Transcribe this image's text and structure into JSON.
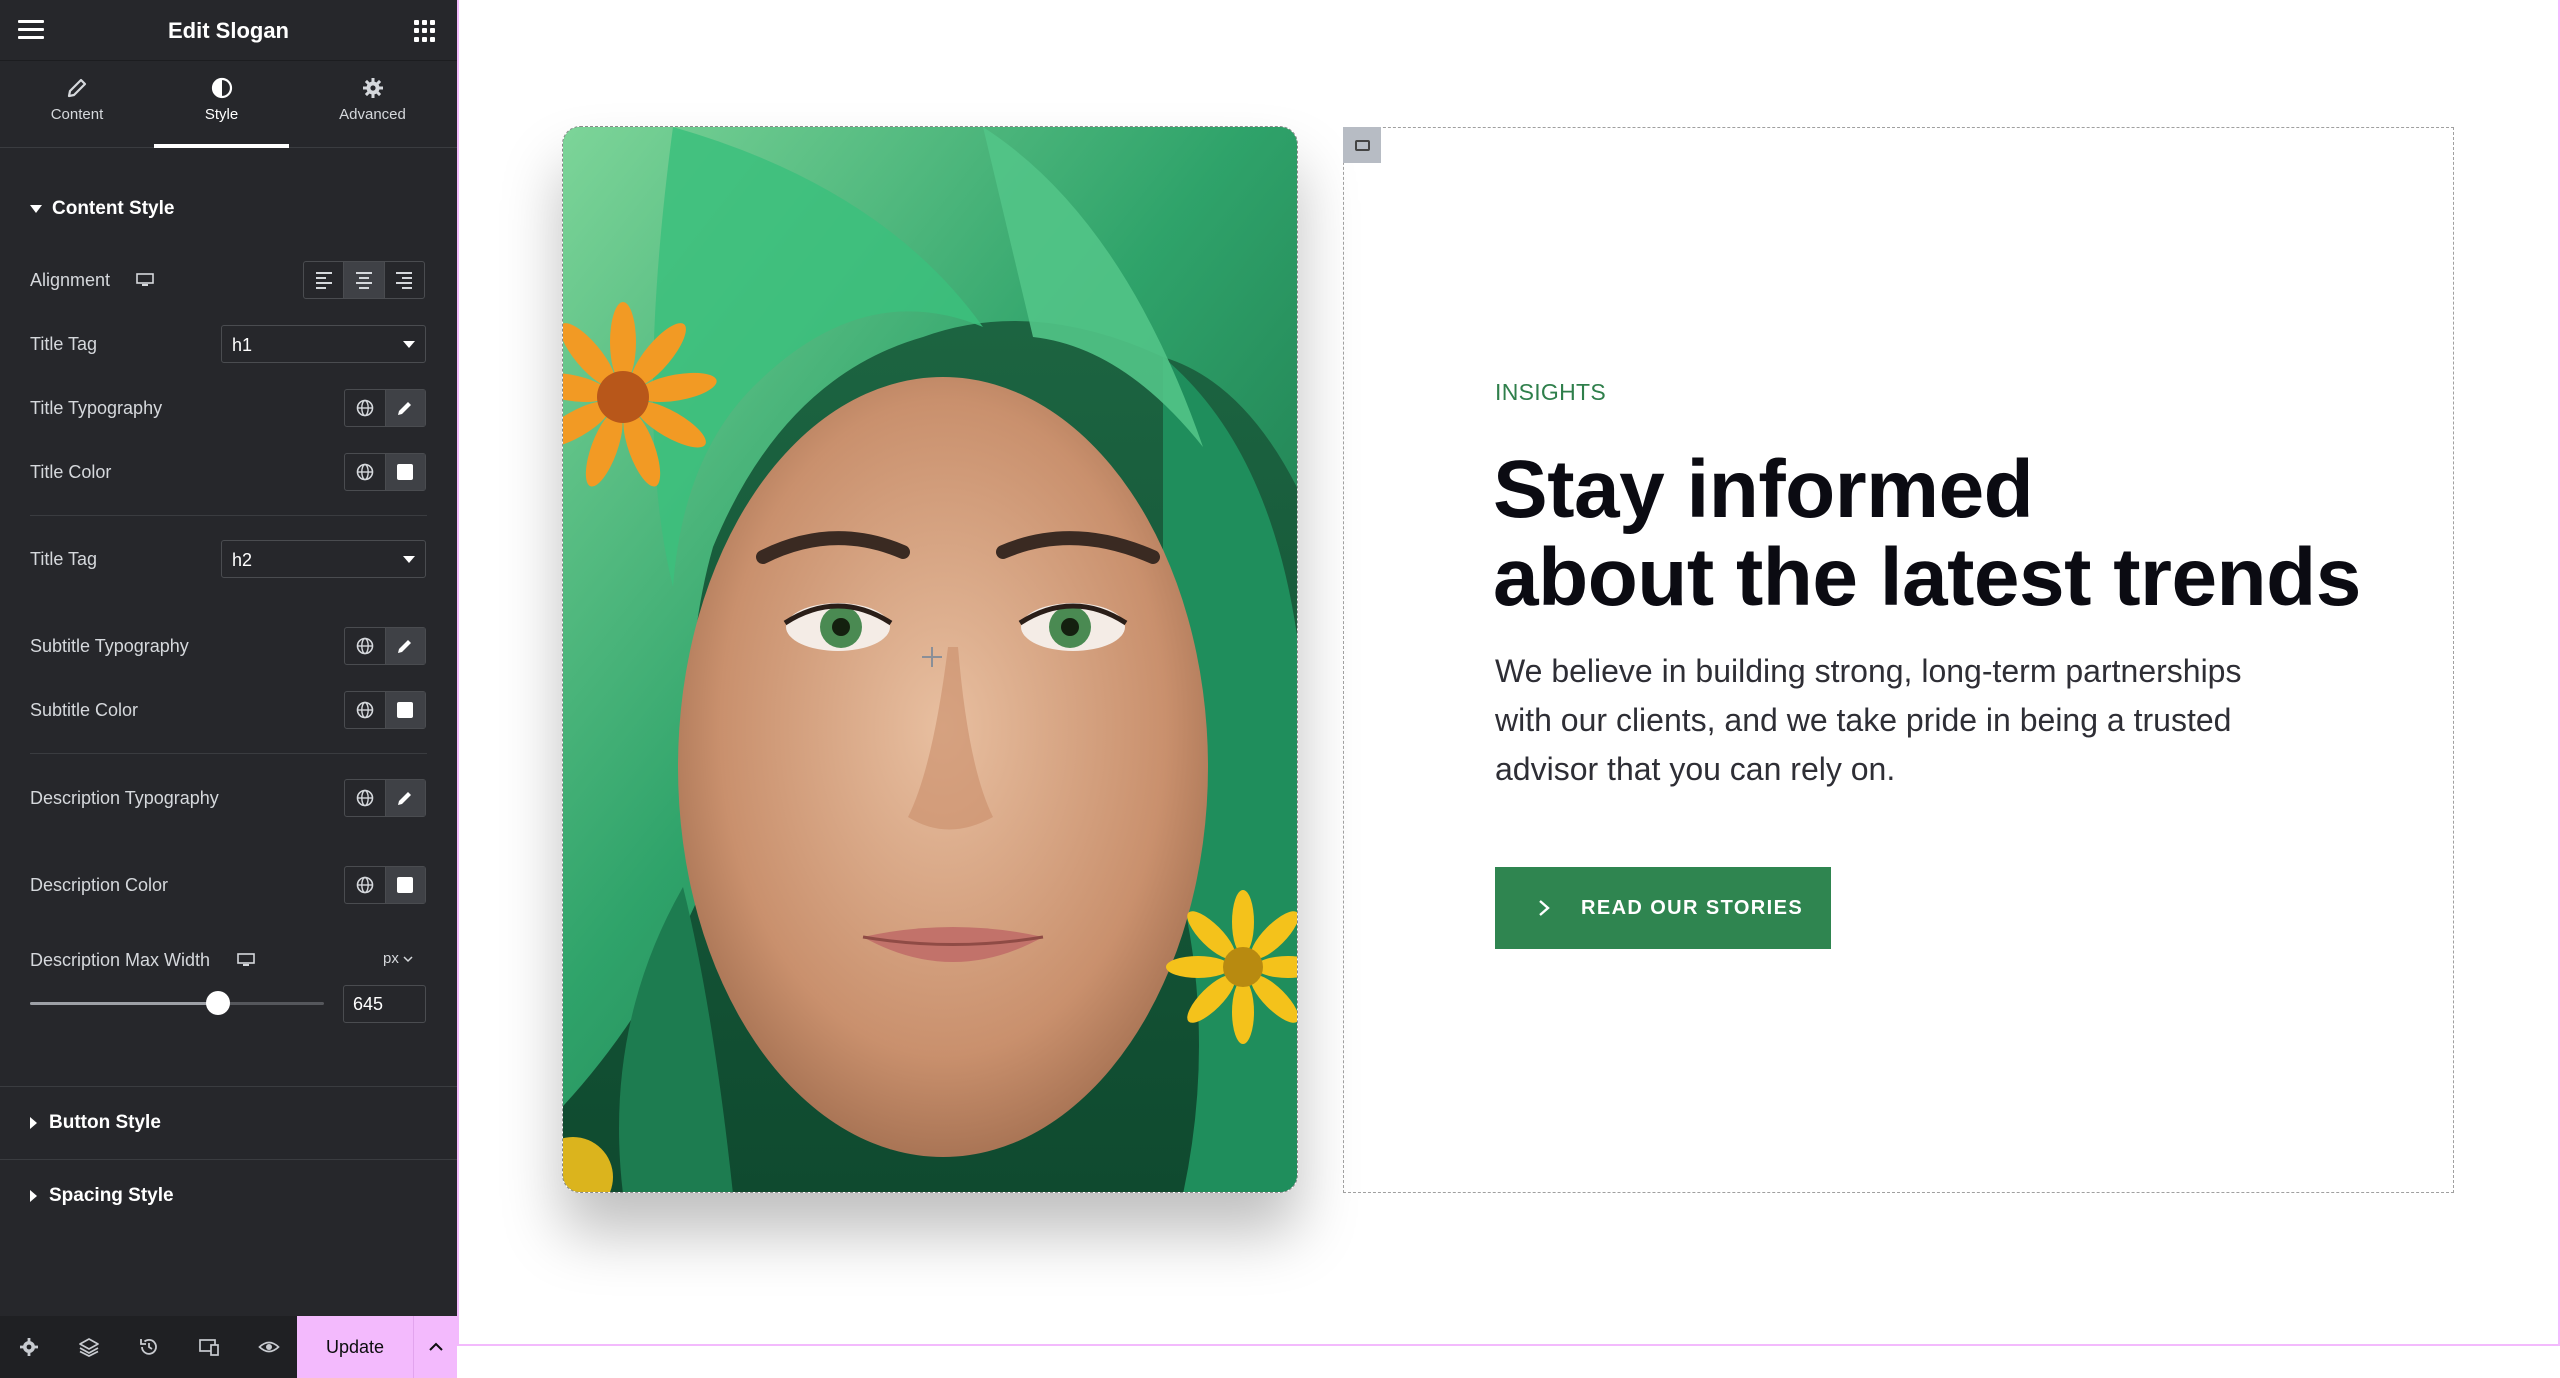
{
  "panel": {
    "title": "Edit Slogan",
    "tabs": [
      {
        "label": "Content",
        "icon": "pencil-icon"
      },
      {
        "label": "Style",
        "icon": "contrast-icon"
      },
      {
        "label": "Advanced",
        "icon": "gear-icon"
      }
    ],
    "active_tab": "Style",
    "content_style": {
      "heading": "Content Style",
      "alignment_label": "Alignment",
      "alignment_selected": "center",
      "title_tag_label": "Title Tag",
      "title_tag_value": "h1",
      "title_typography_label": "Title Typography",
      "title_color_label": "Title Color",
      "subtitle_tag_label": "Title Tag",
      "subtitle_tag_value": "h2",
      "subtitle_typography_label": "Subtitle Typography",
      "subtitle_color_label": "Subtitle Color",
      "description_typography_label": "Description Typography",
      "description_color_label": "Description Color",
      "description_max_width_label": "Description Max Width",
      "description_max_width_unit": "px",
      "description_max_width_value": "645",
      "description_max_width_fraction": 0.64
    },
    "collapsed_sections": [
      "Button Style",
      "Spacing Style"
    ],
    "footer": {
      "update_label": "Update"
    }
  },
  "canvas": {
    "eyebrow": "INSIGHTS",
    "headline_line1": "Stay informed",
    "headline_line2": "about the latest trends",
    "description": "We believe in building strong, long-term partnerships with our clients, and we take pride in being a trusted advisor that you can rely on.",
    "cta_label": "READ OUR STORIES"
  },
  "colors": {
    "panel_bg": "#26272b",
    "accent_pink": "#f3bafd",
    "brand_green": "#2f8550",
    "eyebrow_green": "#2f7f4b"
  }
}
